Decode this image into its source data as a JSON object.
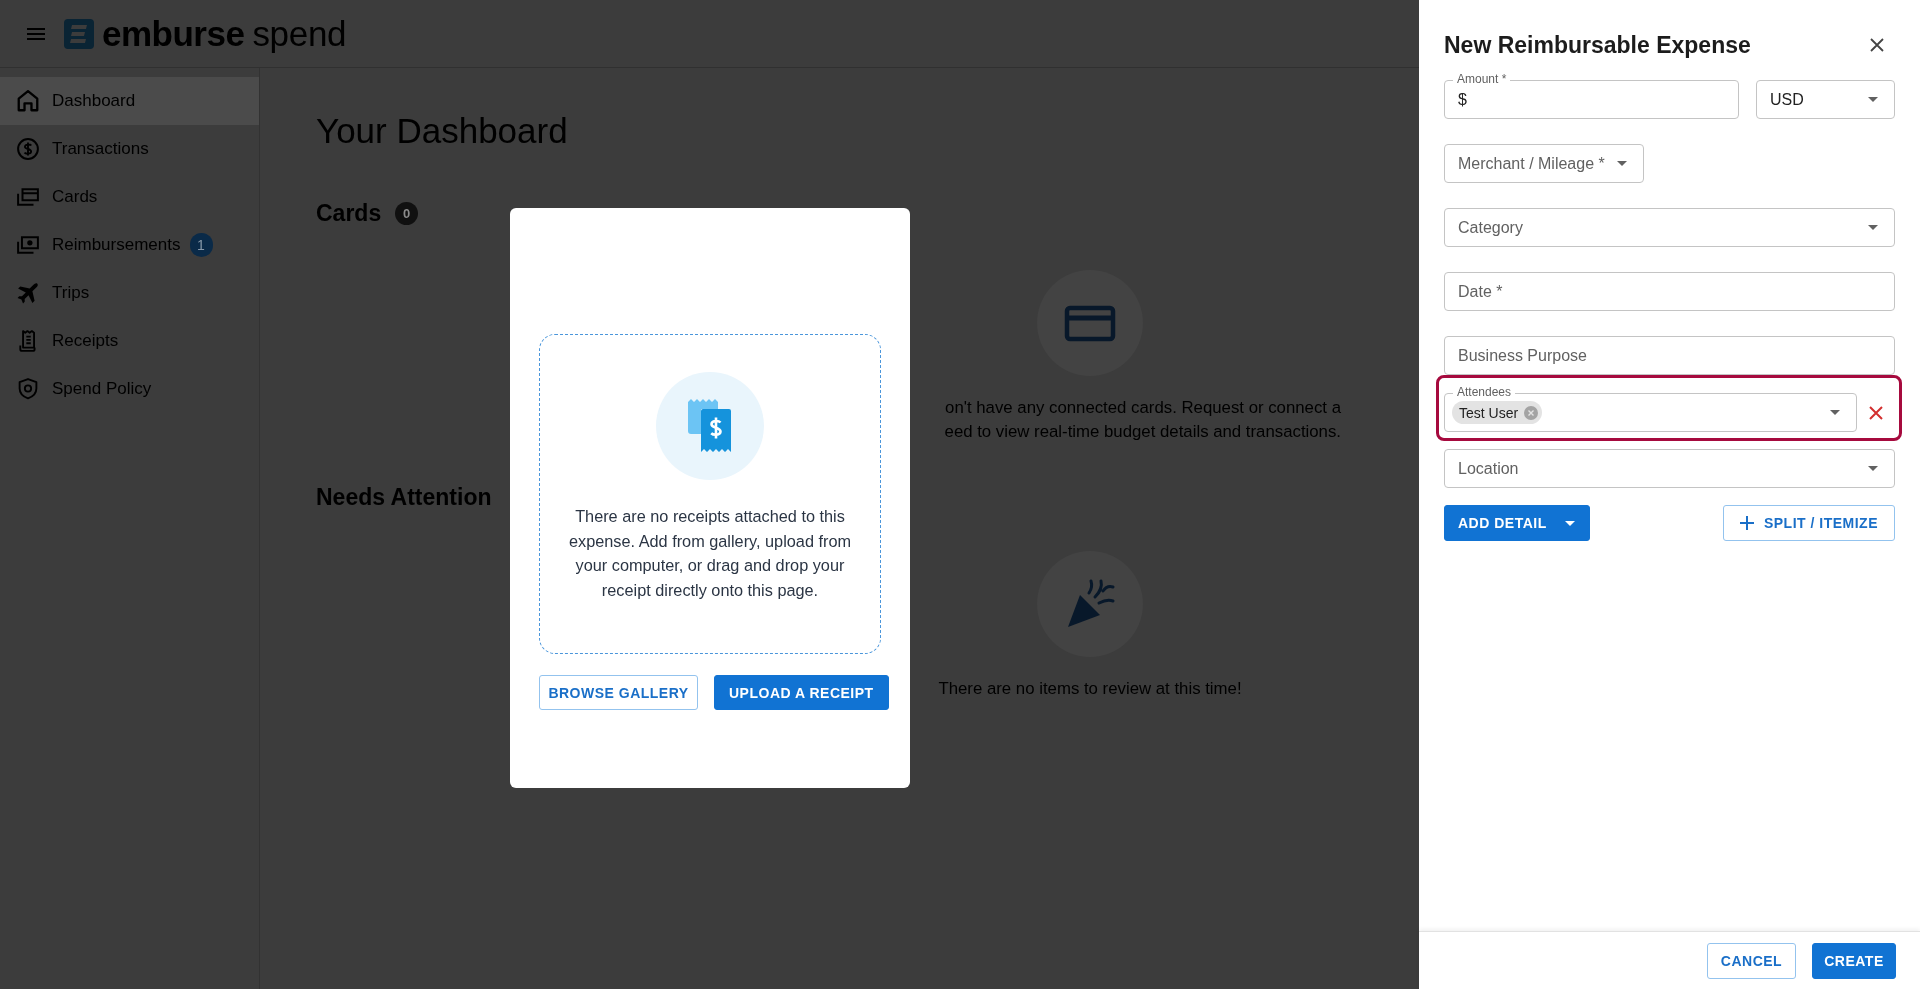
{
  "app_bar": {
    "logo": {
      "brand": "emburse",
      "product": "spend"
    }
  },
  "sidebar": {
    "items": [
      {
        "label": "Dashboard",
        "selected": true
      },
      {
        "label": "Transactions",
        "selected": false
      },
      {
        "label": "Cards",
        "selected": false
      },
      {
        "label": "Reimbursements",
        "selected": false,
        "badge": "1"
      },
      {
        "label": "Trips",
        "selected": false
      },
      {
        "label": "Receipts",
        "selected": false
      },
      {
        "label": "Spend Policy",
        "selected": false
      }
    ]
  },
  "dashboard": {
    "title": "Your Dashboard",
    "sections": [
      {
        "heading": "Cards",
        "count": "0",
        "message_lines": [
          "on't have any connected cards. Request or connect a",
          "eed to view real-time budget details and transactions."
        ]
      },
      {
        "heading": "Needs Attention",
        "message": "There are no items to review at this time!"
      }
    ]
  },
  "receipt_dialog": {
    "message": "There are no receipts attached to this expense. Add from gallery, upload from your computer, or drag and drop your receipt directly onto this page.",
    "buttons": [
      {
        "label": "BROWSE GALLERY",
        "kind": "outlined"
      },
      {
        "label": "UPLOAD A RECEIPT",
        "kind": "contained"
      }
    ]
  },
  "expense_panel": {
    "title": "New Reimbursable Expense",
    "rows": [
      {
        "fields": [
          {
            "kind": "text",
            "label": "Amount *",
            "prefix": "$",
            "highlighted": false,
            "removable": false
          },
          {
            "kind": "select",
            "value": "USD",
            "highlighted": false,
            "removable": false
          }
        ]
      },
      {
        "fields": [
          {
            "kind": "menu",
            "placeholder": "Merchant / Mileage *",
            "highlighted": false,
            "removable": false
          }
        ]
      },
      {
        "fields": [
          {
            "kind": "select",
            "placeholder": "Category",
            "highlighted": false,
            "removable": false
          }
        ]
      },
      {
        "fields": [
          {
            "kind": "text",
            "placeholder": "Date *",
            "highlighted": false,
            "removable": false
          }
        ]
      },
      {
        "fields": [
          {
            "kind": "text",
            "placeholder": "Business Purpose",
            "highlighted": false,
            "removable": false
          }
        ]
      },
      {
        "fields": [
          {
            "kind": "multiselect",
            "label": "Attendees",
            "chips": [
              "Test User"
            ],
            "highlighted": true,
            "removable": true
          }
        ]
      },
      {
        "fields": [
          {
            "kind": "select",
            "placeholder": "Location",
            "highlighted": false,
            "removable": false
          }
        ]
      }
    ],
    "actions": [
      {
        "label": "ADD DETAIL",
        "kind": "dropdown"
      },
      {
        "label": "SPLIT / ITEMIZE",
        "kind": "add"
      }
    ],
    "footer_buttons": [
      {
        "label": "CANCEL",
        "kind": "outlined"
      },
      {
        "label": "CREATE",
        "kind": "contained"
      }
    ]
  }
}
